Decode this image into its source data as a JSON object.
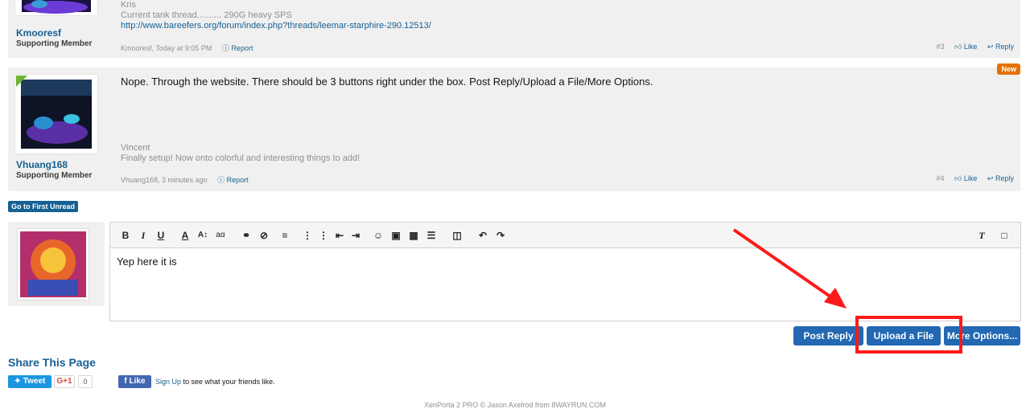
{
  "posts": [
    {
      "username": "Kmooresf",
      "usertitle": "Supporting Member",
      "sig_name": "Kris",
      "sig_line": "Current tank thread.......... 290G heavy SPS",
      "sig_link": "http://www.bareefers.org/forum/index.php?threads/leemar-starphire-290.12513/",
      "meta": "Kmooresf, Today at 9:05 PM",
      "report": "Report",
      "number": "#3",
      "like": "Like",
      "reply": "Reply"
    },
    {
      "username": "Vhuang168",
      "usertitle": "Supporting Member",
      "badge": "New",
      "message": "Nope. Through the website. There should be 3 buttons right under the box. Post Reply/Upload a File/More Options.",
      "sig_name": "Vincent",
      "sig_line": "Finally setup! Now onto colorful and interesting things to add!",
      "meta": "Vhuang168, 3 minutes ago",
      "report": "Report",
      "number": "#4",
      "like": "Like",
      "reply": "Reply"
    }
  ],
  "first_unread": "Go to First Unread",
  "editor": {
    "text": "Yep here it is"
  },
  "buttons": {
    "post_reply": "Post Reply",
    "upload_file": "Upload a File",
    "more_options": "More Options..."
  },
  "share": {
    "title": "Share This Page",
    "tweet": "Tweet",
    "gplus": "G+1",
    "gplus_count": "0",
    "fb_like": "Like",
    "fb_signup": "Sign Up",
    "fb_rest": " to see what your friends like."
  },
  "footer": "XenPorta 2 PRO © Jason Axelrod from 8WAYRUN.COM",
  "colors": {
    "accent": "#176093",
    "button": "#2268b2",
    "annotation": "#ff1a1a",
    "new_badge": "#e47000"
  }
}
